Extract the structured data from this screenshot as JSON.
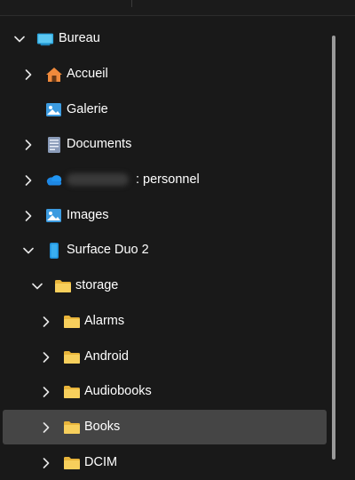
{
  "tree": {
    "items": [
      {
        "label": "Bureau",
        "icon": "desktop-icon"
      },
      {
        "label": "Accueil",
        "icon": "home-icon"
      },
      {
        "label": "Galerie",
        "icon": "gallery-icon"
      },
      {
        "label": "Documents",
        "icon": "document-icon"
      },
      {
        "label": ": personnel",
        "icon": "onedrive-cloud-icon"
      },
      {
        "label": "Images",
        "icon": "pictures-icon"
      },
      {
        "label": "Surface Duo 2",
        "icon": "phone-icon"
      },
      {
        "label": "storage",
        "icon": "folder-icon"
      },
      {
        "label": "Alarms",
        "icon": "folder-icon"
      },
      {
        "label": "Android",
        "icon": "folder-icon"
      },
      {
        "label": "Audiobooks",
        "icon": "folder-icon"
      },
      {
        "label": "Books",
        "icon": "folder-icon",
        "selected": true
      },
      {
        "label": "DCIM",
        "icon": "folder-icon"
      }
    ]
  },
  "colors": {
    "background": "#191919",
    "selected_row": "#454545",
    "folder": "#f5c94a",
    "accent_blue": "#4aa8e8"
  }
}
